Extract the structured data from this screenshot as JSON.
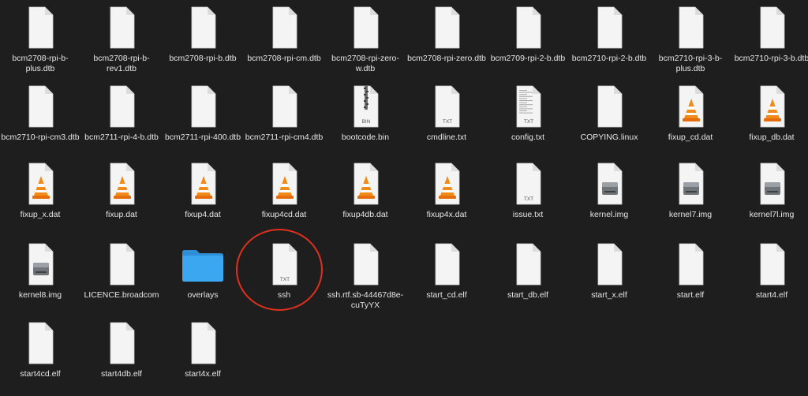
{
  "colors": {
    "background": "#1e1e1e",
    "label": "#e6e6e6",
    "highlight": "#e0301e",
    "folder": "#3aa7f0"
  },
  "files": [
    {
      "name": "bcm2708-rpi-b-plus.dtb",
      "icon": "document-icon",
      "badge": ""
    },
    {
      "name": "bcm2708-rpi-b-rev1.dtb",
      "icon": "document-icon",
      "badge": ""
    },
    {
      "name": "bcm2708-rpi-b.dtb",
      "icon": "document-icon",
      "badge": ""
    },
    {
      "name": "bcm2708-rpi-cm.dtb",
      "icon": "document-icon",
      "badge": ""
    },
    {
      "name": "bcm2708-rpi-zero-w.dtb",
      "icon": "document-icon",
      "badge": ""
    },
    {
      "name": "bcm2708-rpi-zero.dtb",
      "icon": "document-icon",
      "badge": ""
    },
    {
      "name": "bcm2709-rpi-2-b.dtb",
      "icon": "document-icon",
      "badge": ""
    },
    {
      "name": "bcm2710-rpi-2-b.dtb",
      "icon": "document-icon",
      "badge": ""
    },
    {
      "name": "bcm2710-rpi-3-b-plus.dtb",
      "icon": "document-icon",
      "badge": ""
    },
    {
      "name": "bcm2710-rpi-3-b.dtb",
      "icon": "document-icon",
      "badge": ""
    },
    {
      "name": "bcm2710-rpi-cm3.dtb",
      "icon": "document-icon",
      "badge": ""
    },
    {
      "name": "bcm2711-rpi-4-b.dtb",
      "icon": "document-icon",
      "badge": ""
    },
    {
      "name": "bcm2711-rpi-400.dtb",
      "icon": "document-icon",
      "badge": ""
    },
    {
      "name": "bcm2711-rpi-cm4.dtb",
      "icon": "document-icon",
      "badge": ""
    },
    {
      "name": "bootcode.bin",
      "icon": "binary-file-icon",
      "badge": "BIN"
    },
    {
      "name": "cmdline.txt",
      "icon": "text-file-icon",
      "badge": "TXT"
    },
    {
      "name": "config.txt",
      "icon": "text-preview-file-icon",
      "badge": "TXT"
    },
    {
      "name": "COPYING.linux",
      "icon": "document-icon",
      "badge": ""
    },
    {
      "name": "fixup_cd.dat",
      "icon": "vlc-cone-icon",
      "badge": ""
    },
    {
      "name": "fixup_db.dat",
      "icon": "vlc-cone-icon",
      "badge": ""
    },
    {
      "name": "fixup_x.dat",
      "icon": "vlc-cone-icon",
      "badge": ""
    },
    {
      "name": "fixup.dat",
      "icon": "vlc-cone-icon",
      "badge": ""
    },
    {
      "name": "fixup4.dat",
      "icon": "vlc-cone-icon",
      "badge": ""
    },
    {
      "name": "fixup4cd.dat",
      "icon": "vlc-cone-icon",
      "badge": ""
    },
    {
      "name": "fixup4db.dat",
      "icon": "vlc-cone-icon",
      "badge": ""
    },
    {
      "name": "fixup4x.dat",
      "icon": "vlc-cone-icon",
      "badge": ""
    },
    {
      "name": "issue.txt",
      "icon": "text-file-icon",
      "badge": "TXT"
    },
    {
      "name": "kernel.img",
      "icon": "disk-image-icon",
      "badge": ""
    },
    {
      "name": "kernel7.img",
      "icon": "disk-image-icon",
      "badge": ""
    },
    {
      "name": "kernel7l.img",
      "icon": "disk-image-icon",
      "badge": ""
    },
    {
      "name": "kernel8.img",
      "icon": "disk-image-icon",
      "badge": ""
    },
    {
      "name": "LICENCE.broadcom",
      "icon": "document-icon",
      "badge": ""
    },
    {
      "name": "overlays",
      "icon": "folder-icon",
      "badge": ""
    },
    {
      "name": "ssh",
      "icon": "text-file-icon",
      "badge": "TXT"
    },
    {
      "name": "ssh.rtf.sb-44467d8e-cuTyYX",
      "icon": "document-icon",
      "badge": ""
    },
    {
      "name": "start_cd.elf",
      "icon": "document-icon",
      "badge": ""
    },
    {
      "name": "start_db.elf",
      "icon": "document-icon",
      "badge": ""
    },
    {
      "name": "start_x.elf",
      "icon": "document-icon",
      "badge": ""
    },
    {
      "name": "start.elf",
      "icon": "document-icon",
      "badge": ""
    },
    {
      "name": "start4.elf",
      "icon": "document-icon",
      "badge": ""
    },
    {
      "name": "start4cd.elf",
      "icon": "document-icon",
      "badge": ""
    },
    {
      "name": "start4db.elf",
      "icon": "document-icon",
      "badge": ""
    },
    {
      "name": "start4x.elf",
      "icon": "document-icon",
      "badge": ""
    }
  ],
  "highlight": {
    "target": "ssh"
  }
}
